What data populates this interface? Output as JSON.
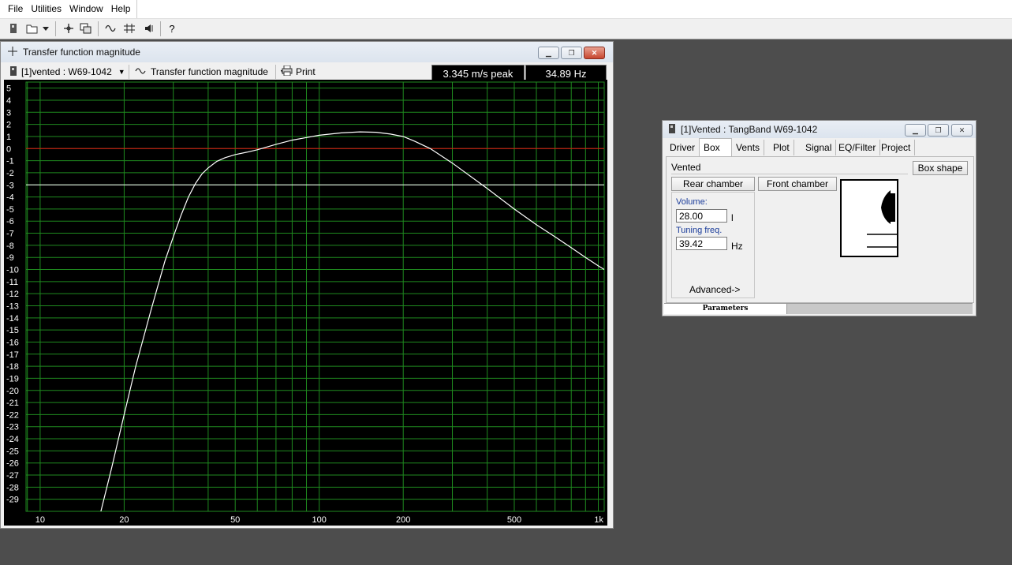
{
  "menu": [
    "File",
    "Utilities",
    "Window",
    "Help"
  ],
  "toolbar_icons": [
    "new-project-icon",
    "open-folder-icon",
    "dropdown-arrow-icon",
    "crosshair-icon",
    "copy-window-icon",
    "sine-wave-icon",
    "filter-icon",
    "speaker-icon",
    "help-icon"
  ],
  "toolbar_help_glyph": "?",
  "tf_window": {
    "title": "Transfer function magnitude",
    "driver_select": "[1]vented : W69-1042",
    "plot_select": "Transfer function magnitude",
    "print_label": "Print",
    "readout_value": "3.345 m/s peak",
    "readout_freq": "34.89 Hz"
  },
  "chart_data": {
    "type": "line",
    "title": "",
    "xlabel": "",
    "ylabel": "",
    "x_scale": "log",
    "xlim": [
      8.9,
      1050
    ],
    "ylim": [
      -30,
      5.5
    ],
    "x_ticks": [
      10,
      20,
      50,
      100,
      200,
      500,
      1000
    ],
    "x_tick_labels": [
      "10",
      "20",
      "50",
      "100",
      "200",
      "500",
      "1k"
    ],
    "y_ticks": [
      5,
      4,
      3,
      2,
      1,
      0,
      -1,
      -2,
      -3,
      -4,
      -5,
      -6,
      -7,
      -8,
      -9,
      -10,
      -11,
      -12,
      -13,
      -14,
      -15,
      -16,
      -17,
      -18,
      -19,
      -20,
      -21,
      -22,
      -23,
      -24,
      -25,
      -26,
      -27,
      -28,
      -29
    ],
    "y_tick_labels": [
      "5",
      "4",
      "3",
      "2",
      "1",
      "0",
      "-1",
      "-2",
      "-3",
      "-4",
      "-5",
      "-6",
      "-7",
      "-8",
      "-9",
      "-10",
      "-11",
      "-12",
      "-13",
      "-14",
      "-15",
      "-16",
      "-17",
      "-18",
      "-19",
      "-20",
      "-21",
      "-22",
      "-23",
      "-24",
      "-25",
      "-26",
      "-27",
      "-28",
      "-29"
    ],
    "grid": true,
    "background": "#000000",
    "grid_color": "#1f8a1f",
    "reference_lines": [
      {
        "y": 0,
        "color": "#e01010"
      },
      {
        "y": -3,
        "color": "#ffffff"
      }
    ],
    "series": [
      {
        "color": "#ffffff",
        "x": [
          16.5,
          18,
          20,
          22,
          25,
          28,
          30,
          32,
          34,
          36,
          38,
          40,
          43,
          46,
          50,
          55,
          60,
          70,
          80,
          100,
          120,
          140,
          160,
          180,
          200,
          220,
          250,
          300,
          400,
          500,
          600,
          700,
          800,
          900,
          1000,
          1050
        ],
        "y": [
          -30,
          -26.5,
          -22,
          -18,
          -13.3,
          -9.3,
          -7.3,
          -5.5,
          -4.0,
          -2.9,
          -2.1,
          -1.6,
          -1.05,
          -0.75,
          -0.5,
          -0.3,
          -0.1,
          0.35,
          0.7,
          1.1,
          1.3,
          1.38,
          1.35,
          1.2,
          1.0,
          0.6,
          0.0,
          -1.2,
          -3.3,
          -5.0,
          -6.3,
          -7.3,
          -8.2,
          -9.0,
          -9.7,
          -10.0
        ]
      }
    ]
  },
  "box_window": {
    "title": "[1]Vented : TangBand W69-1042",
    "tabs": [
      "Driver",
      "Box",
      "Vents",
      "Plot",
      "Signal",
      "EQ/Filter",
      "Project"
    ],
    "active_tab": "Box",
    "box_type": "Vented",
    "box_shape_label": "Box shape",
    "rear_chamber_label": "Rear chamber",
    "front_chamber_label": "Front chamber",
    "volume_label": "Volume:",
    "volume_value": "28.00",
    "volume_unit": "l",
    "tuning_label": "Tuning freq.",
    "tuning_value": "39.42",
    "tuning_unit": "Hz",
    "advanced_label": "Advanced->",
    "status_tab": "Parameters"
  }
}
